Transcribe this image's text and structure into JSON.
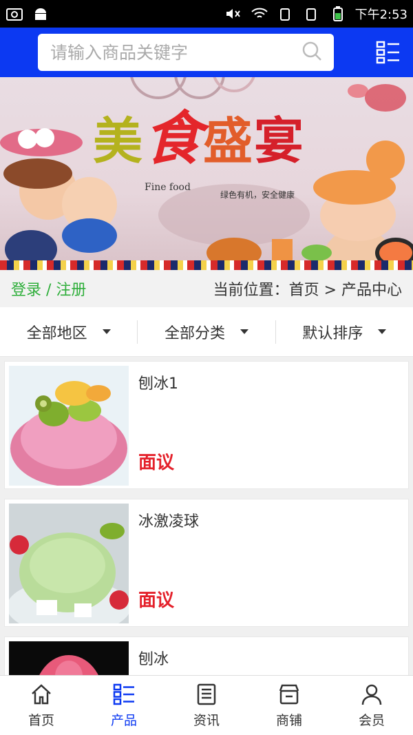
{
  "status_bar": {
    "time": "下午2:53"
  },
  "search": {
    "placeholder": "请输入商品关键字"
  },
  "banner": {
    "title_chars": [
      "美",
      "食",
      "盛",
      "宴"
    ],
    "fine_food": "Fine food",
    "subtitle": "绿色有机，安全健康"
  },
  "info_bar": {
    "login_register": "登录 / 注册",
    "breadcrumb": "当前位置：首页 > 产品中心"
  },
  "filters": [
    {
      "label": "全部地区"
    },
    {
      "label": "全部分类"
    },
    {
      "label": "默认排序"
    }
  ],
  "products": [
    {
      "name": "刨冰1",
      "price": "面议"
    },
    {
      "name": "冰激凌球",
      "price": "面议"
    },
    {
      "name": "刨冰",
      "price": ""
    }
  ],
  "tabs": [
    {
      "label": "首页",
      "icon": "home-icon"
    },
    {
      "label": "产品",
      "icon": "products-icon"
    },
    {
      "label": "资讯",
      "icon": "news-icon"
    },
    {
      "label": "商铺",
      "icon": "store-icon"
    },
    {
      "label": "会员",
      "icon": "member-icon"
    }
  ],
  "colors": {
    "primary": "#0c39f2",
    "accent_red": "#e4202a",
    "login_green": "#2eae3a"
  }
}
